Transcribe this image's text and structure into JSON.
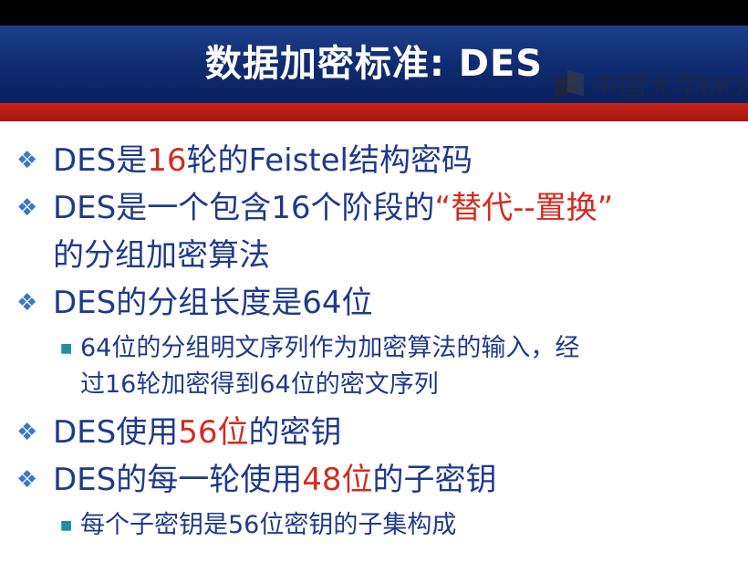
{
  "slide": {
    "title": "数据加密标准: DES",
    "watermark": "中国大学MO",
    "colors": {
      "title_bg": "#0f2a6e",
      "red_strip": "#b81b12",
      "body_text": "#1e3a8a",
      "highlight": "#d42a20"
    }
  },
  "bullets": [
    {
      "pre": "DES是",
      "red": "16",
      "post": "轮的Feistel结构密码"
    },
    {
      "pre": "DES是一个包含16个阶段的",
      "red": "“替代--置换”",
      "post": "",
      "line2": "的分组加密算法"
    },
    {
      "pre": "DES的分组长度是64位",
      "red": "",
      "post": "",
      "sub": {
        "line1": "64位的分组明文序列作为加密算法的输入，经",
        "line2": "过16轮加密得到64位的密文序列"
      }
    },
    {
      "pre": "DES使用",
      "red": "56位",
      "post": "的密钥"
    },
    {
      "pre": "DES的每一轮使用",
      "red": "48位",
      "post": "的子密钥",
      "sub": {
        "line1": "每个子密钥是56位密钥的子集构成"
      }
    }
  ],
  "icons": {
    "level1_bullet": "diamond-bullet-icon",
    "level2_bullet": "square-bullet-icon"
  }
}
